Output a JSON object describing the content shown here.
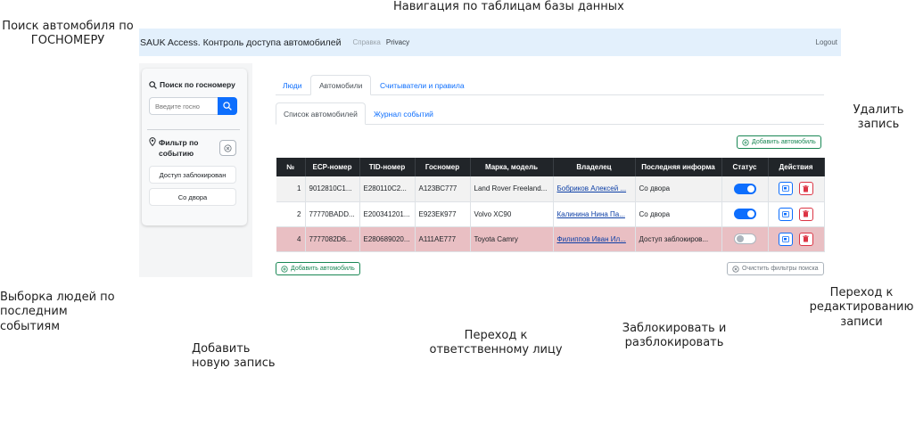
{
  "annotations": {
    "top": "Навигация по таблицам базы данных",
    "search_line1": "Поиск автомобиля по",
    "search_line2": "ГОСНОМЕРУ",
    "delete_line1": "Удалить",
    "delete_line2": "запись",
    "filter_line1": "Выборка  людей  по",
    "filter_line2": "последним",
    "filter_line3": "событиям",
    "edit_line1": "Переход к",
    "edit_line2": "редактированию",
    "edit_line3": "записи",
    "add_line1": "Добавить",
    "add_line2": "новую запись",
    "owner_line1": "Переход к",
    "owner_line2": "ответственному лицу",
    "block_line1": "Заблокировать и",
    "block_line2": "разблокировать"
  },
  "navbar": {
    "brand": "SAUK Access. Контроль доступа автомобилей",
    "links": [
      "Справка",
      "Privacy"
    ],
    "logout": "Logout"
  },
  "sidebar": {
    "search_title": "Поиск по госномеру",
    "search_placeholder": "Введите госно",
    "filter_title_line1": "Фильтр по",
    "filter_title_line2": "событию",
    "filters": [
      "Доступ заблокирован",
      "Со двора"
    ]
  },
  "tabs": [
    {
      "label": "Люди",
      "active": false
    },
    {
      "label": "Автомобили",
      "active": true
    },
    {
      "label": "Считыватели и правила",
      "active": false
    }
  ],
  "subtabs": [
    {
      "label": "Список автомобилей",
      "active": true
    },
    {
      "label": "Журнал событий",
      "active": false
    }
  ],
  "buttons": {
    "add_top": "Добавить автомобиль",
    "add_bottom": "Добавить автомобиль",
    "clear_filters": "Очистить фильтры поиска"
  },
  "table": {
    "headers": [
      "№",
      "ЕСР-номер",
      "TID-номер",
      "Госномер",
      "Марка, модель",
      "Владелец",
      "Последняя информа",
      "Статус",
      "Действия"
    ],
    "rows": [
      {
        "num": "1",
        "ecp": "9012810C1...",
        "tid": "E280110C2...",
        "plate": "А123ВС777",
        "model": "Land Rover Freeland...",
        "owner": "Бобриков Алексей ...",
        "last": "Со двора",
        "status": "on",
        "blocked": false
      },
      {
        "num": "2",
        "ecp": "77770BADD...",
        "tid": "E200341201...",
        "plate": "Е923ЕК977",
        "model": "Volvo XC90",
        "owner": "Калинина Нина Па...",
        "last": "Со двора",
        "status": "on",
        "blocked": false
      },
      {
        "num": "4",
        "ecp": "7777082D6...",
        "tid": "E280689020...",
        "plate": "А111АЕ777",
        "model": "Toyota Camry",
        "owner": "Филиппов Иван Ил...",
        "last": "Доступ заблокиров...",
        "status": "off",
        "blocked": true
      }
    ]
  },
  "colors": {
    "primary": "#0d6efd",
    "success": "#198754",
    "danger": "#dc3545",
    "navbar_bg": "#e3f0fc",
    "blocked_row": "#e9bfc3",
    "table_head": "#212529"
  },
  "icons": [
    "search-icon",
    "geo-pin-icon",
    "clear-filter-icon",
    "plus-circle-icon",
    "edit-icon",
    "trash-icon",
    "x-circle-icon"
  ]
}
